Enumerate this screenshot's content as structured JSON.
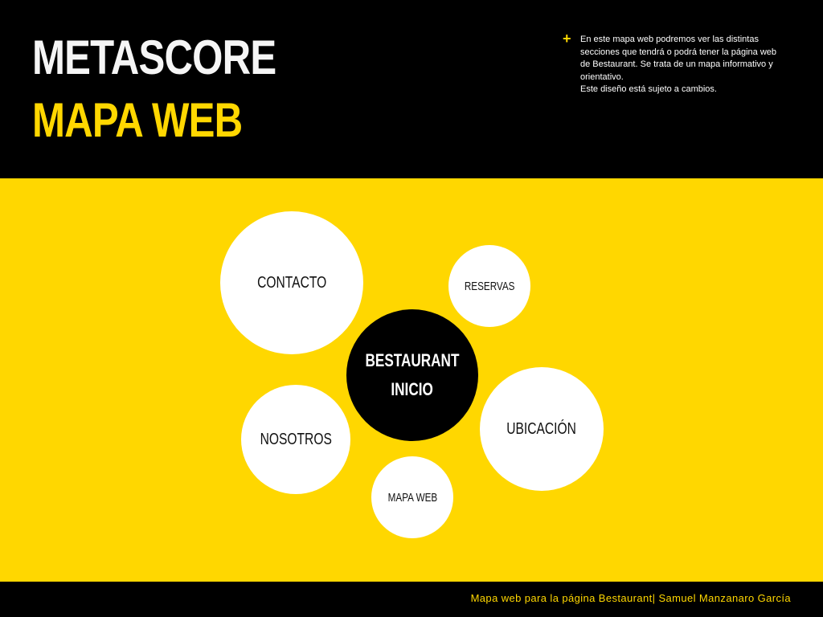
{
  "header": {
    "title_line1": "METASCORE",
    "title_line2": "MAPA WEB",
    "note_icon": "+",
    "note_lines": [
      "En este mapa web podremos ver las distintas",
      "secciones que tendrá o podrá tener la página web",
      "de Bestaurant. Se trata de un mapa informativo y",
      "orientativo.",
      "Este diseño está sujeto a cambios."
    ]
  },
  "sitemap": {
    "center": {
      "line1": "BESTAURANT",
      "line2": "INICIO"
    },
    "nodes": {
      "contacto": "CONTACTO",
      "reservas": "RESERVAS",
      "nosotros": "NOSOTROS",
      "ubicacion": "UBICACIÓN",
      "mapa_web": "MAPA WEB"
    }
  },
  "footer": {
    "text": "Mapa web para la página Bestaurant| Samuel Manzanaro García"
  },
  "colors": {
    "accent": "#ffd700",
    "dark": "#000000",
    "light": "#ffffff"
  }
}
